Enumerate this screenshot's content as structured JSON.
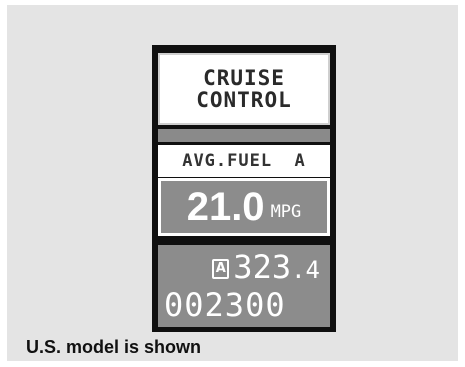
{
  "display": {
    "mode_line1": "CRUISE",
    "mode_line2": "CONTROL",
    "info_label": "AVG.FUEL  A",
    "fuel_value": "21.0",
    "fuel_unit": "MPG",
    "trip_badge": "A",
    "trip_value": "323",
    "trip_decimal": ".4",
    "odometer": "002300"
  },
  "caption": "U.S. model is shown",
  "colors": {
    "background": "#e4e4e4",
    "display_bezel": "#101010",
    "segment_grey": "#8c8c8c"
  }
}
